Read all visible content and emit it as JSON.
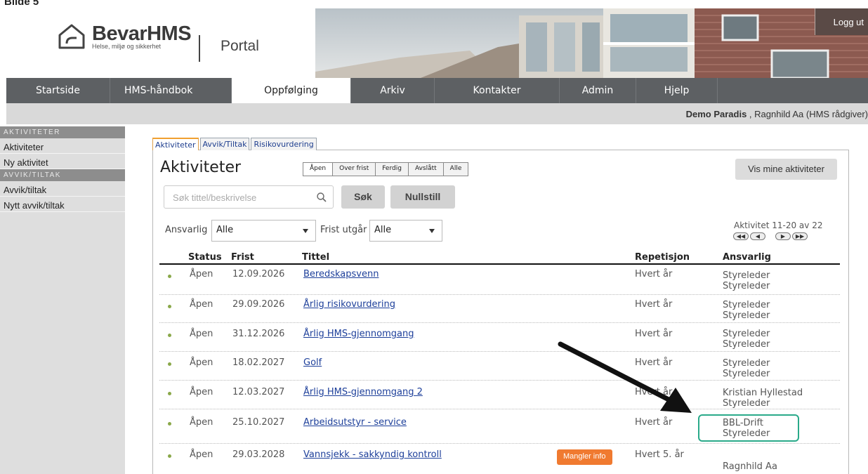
{
  "caption": "Bilde 5",
  "header": {
    "logo_name": "BevarHMS",
    "logo_sub": "Helse, miljø og sikkerhet",
    "portal": "Portal",
    "logout": "Logg ut"
  },
  "nav": [
    "Startside",
    "HMS-håndbok",
    "Oppfølging",
    "Arkiv",
    "Kontakter",
    "Admin",
    "Hjelp"
  ],
  "nav_active": "Oppfølging",
  "userbar": {
    "org": "Demo Paradis",
    "user": " , Ragnhild Aa (HMS rådgiver)"
  },
  "sidebar": {
    "aktiviteter_head": "AKTIVITETER",
    "aktiviteter_items": [
      "Aktiviteter",
      "Ny aktivitet"
    ],
    "avvik_head": "AVVIK/TILTAK",
    "avvik_items": [
      "Avvik/tiltak",
      "Nytt avvik/tiltak"
    ]
  },
  "tabs": [
    "Aktiviteter",
    "Avvik/Tiltak",
    "Risikovurdering"
  ],
  "main": {
    "title": "Aktiviteter",
    "filters": [
      "Åpen",
      "Over frist",
      "Ferdig",
      "Avslått",
      "Alle"
    ],
    "vis_mine": "Vis mine aktiviteter",
    "search_placeholder": "Søk tittel/beskrivelse",
    "search_btn": "Søk",
    "reset_btn": "Nullstill",
    "ansvarlig_label": "Ansvarlig",
    "ansvarlig_value": "Alle",
    "frist_label": "Frist utgår",
    "frist_value": "Alle",
    "pager_text": "Aktivitet 11-20 av 22",
    "pager_buttons": [
      "◀◀",
      "◀",
      "▶",
      "▶▶"
    ]
  },
  "table": {
    "headers": {
      "status": "Status",
      "frist": "Frist",
      "tittel": "Tittel",
      "repetisjon": "Repetisjon",
      "ansvarlig": "Ansvarlig"
    },
    "rows": [
      {
        "status": "Åpen",
        "frist": "12.09.2026",
        "tittel": "Beredskapsvenn",
        "badge": "",
        "repetisjon": "Hvert år",
        "ansvarlig1": "Styreleder",
        "ansvarlig2": "Styreleder"
      },
      {
        "status": "Åpen",
        "frist": "29.09.2026",
        "tittel": "Årlig risikovurdering",
        "badge": "",
        "repetisjon": "Hvert år",
        "ansvarlig1": "Styreleder",
        "ansvarlig2": "Styreleder"
      },
      {
        "status": "Åpen",
        "frist": "31.12.2026",
        "tittel": "Årlig HMS-gjennomgang",
        "badge": "",
        "repetisjon": "Hvert år",
        "ansvarlig1": "Styreleder",
        "ansvarlig2": "Styreleder"
      },
      {
        "status": "Åpen",
        "frist": "18.02.2027",
        "tittel": "Golf",
        "badge": "",
        "repetisjon": "Hvert år",
        "ansvarlig1": "Styreleder",
        "ansvarlig2": "Styreleder"
      },
      {
        "status": "Åpen",
        "frist": "12.03.2027",
        "tittel": "Årlig HMS-gjennomgang 2",
        "badge": "",
        "repetisjon": "Hvert år",
        "ansvarlig1": "Kristian Hyllestad",
        "ansvarlig2": "Styreleder"
      },
      {
        "status": "Åpen",
        "frist": "25.10.2027",
        "tittel": "Arbeidsutstyr - service",
        "badge": "",
        "repetisjon": "Hvert år",
        "ansvarlig1": "BBL-Drift",
        "ansvarlig2": "Styreleder"
      },
      {
        "status": "Åpen",
        "frist": "29.03.2028",
        "tittel": "Vannsjekk - sakkyndig kontroll",
        "badge": "Mangler info",
        "repetisjon": "Hvert 5. år",
        "ansvarlig1": "",
        "ansvarlig2": "Ragnhild Aa"
      }
    ]
  },
  "colors": {
    "nav_bg": "#5d6063",
    "badge": "#f07a30",
    "highlight": "#2aaa8a",
    "link": "#1d3f9a",
    "status_dot": "#8aa84a"
  }
}
